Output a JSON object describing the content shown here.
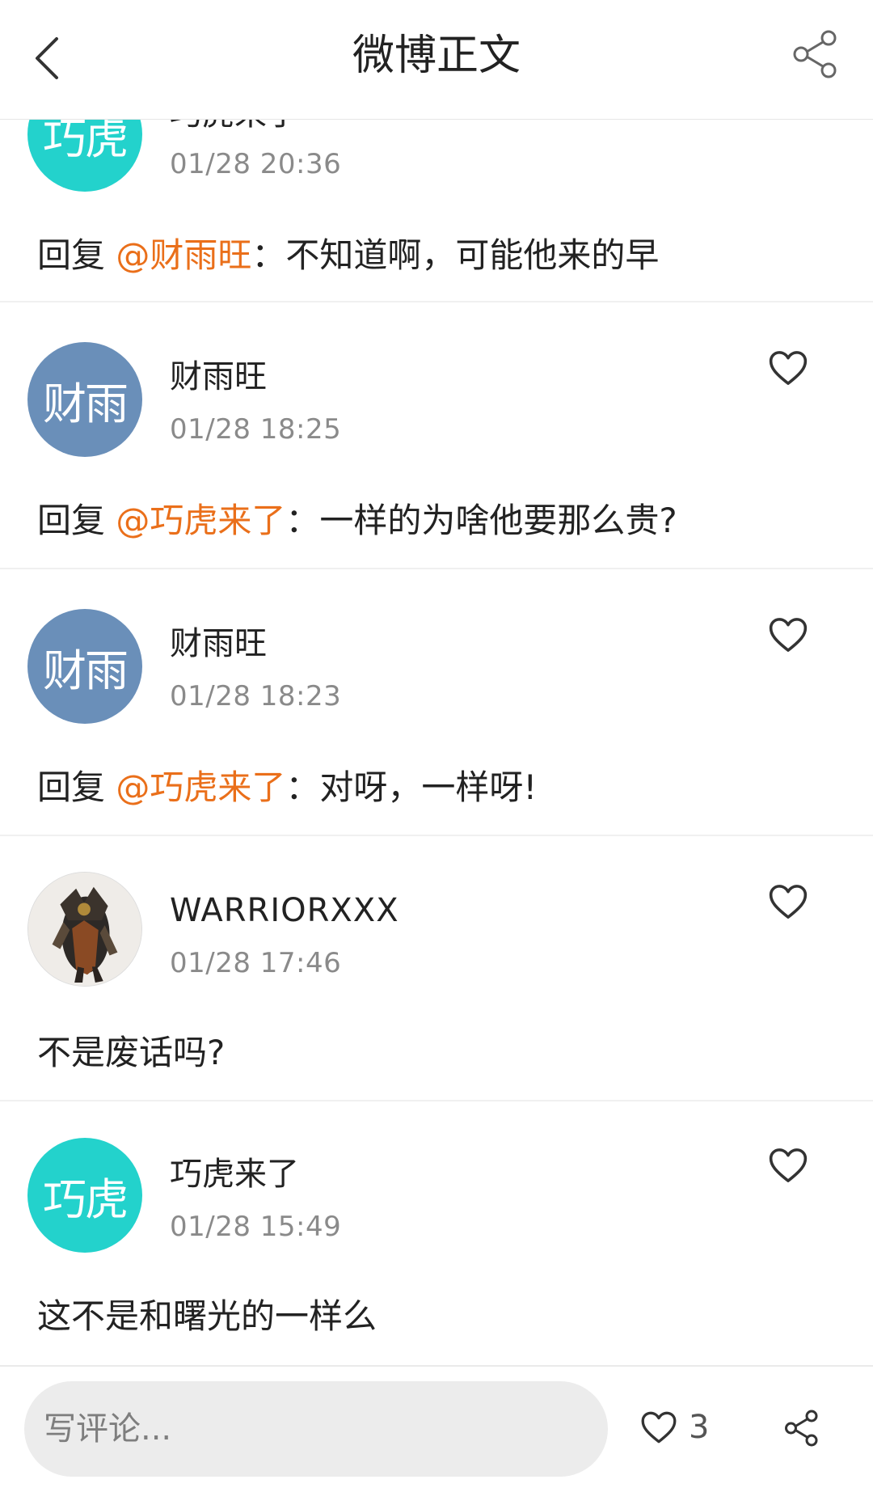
{
  "header": {
    "title": "微博正文",
    "back_icon": "chevron-left-icon",
    "share_icon": "share-icon"
  },
  "colors": {
    "mention": "#ea6f1a",
    "avatar_teal": "#23d2cc",
    "avatar_blue": "#6a8fb9"
  },
  "comments": [
    {
      "username": "巧虎来了",
      "avatar_text": "巧虎",
      "time": "01/28 20:36",
      "reply_prefix": "回复 ",
      "mention": "@财雨旺",
      "text": "：不知道啊，可能他来的早"
    },
    {
      "username": "财雨旺",
      "avatar_text": "财雨",
      "time": "01/28 18:25",
      "reply_prefix": "回复 ",
      "mention": "@巧虎来了",
      "text": "：一样的为啥他要那么贵?"
    },
    {
      "username": "财雨旺",
      "avatar_text": "财雨",
      "time": "01/28 18:23",
      "reply_prefix": "回复 ",
      "mention": "@巧虎来了",
      "text": "：对呀，一样呀!"
    },
    {
      "username": "WARRIORXXX",
      "avatar_text": "",
      "time": "01/28 17:46",
      "text": "不是废话吗?"
    },
    {
      "username": "巧虎来了",
      "avatar_text": "巧虎",
      "time": "01/28 15:49",
      "text": "这不是和曙光的一样么"
    }
  ],
  "bottom_bar": {
    "placeholder": "写评论...",
    "like_count": "3",
    "like_icon": "heart-icon",
    "share_icon": "share-icon"
  }
}
